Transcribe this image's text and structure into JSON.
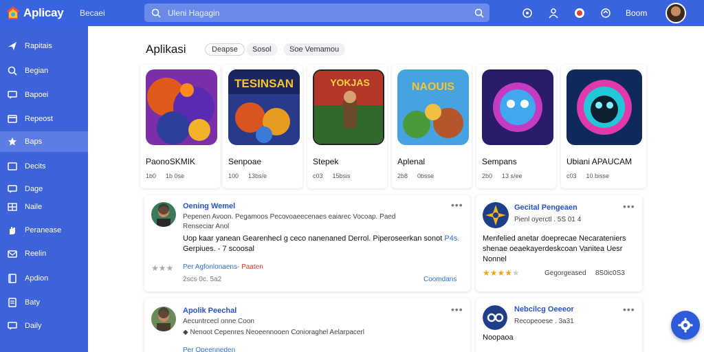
{
  "header": {
    "logo_text": "Aplicay",
    "link": "Becaei",
    "search_placeholder": "Uleni Hagagin",
    "user_label": "Boom"
  },
  "sidebar": {
    "items": [
      {
        "label": "Rapitais",
        "icon": "plane-icon"
      },
      {
        "label": "Begian",
        "icon": "search-icon"
      },
      {
        "label": "Bapoei",
        "icon": "chat-icon"
      },
      {
        "label": "Repeost",
        "icon": "cart-icon"
      },
      {
        "label": "Baps",
        "icon": "star-icon"
      },
      {
        "label": "Decits",
        "icon": "window-icon"
      },
      {
        "label": "Dage",
        "icon": "chat-icon"
      },
      {
        "label": "Naile",
        "icon": "grid-icon"
      },
      {
        "label": "Peranease",
        "icon": "hand-icon"
      },
      {
        "label": "Reelin",
        "icon": "mail-icon"
      },
      {
        "label": "Apdion",
        "icon": "book-icon"
      },
      {
        "label": "Baty",
        "icon": "document-icon"
      },
      {
        "label": "Daily",
        "icon": "chat-icon"
      }
    ]
  },
  "section": {
    "title": "Aplikasi",
    "chips": [
      "Deapse",
      "Sosol",
      "Soe Vemamou"
    ]
  },
  "apps": [
    {
      "name": "PaonoSKMIK",
      "meta1": "1b0",
      "meta2": "1b 0se"
    },
    {
      "name": "Senpoae",
      "meta1": "100",
      "meta2": "13bs/e"
    },
    {
      "name": "Stepek",
      "meta1": "c03",
      "meta2": "15bsis"
    },
    {
      "name": "Aplenal",
      "meta1": "2b8",
      "meta2": "0bsse"
    },
    {
      "name": "Sempans",
      "meta1": "2b0",
      "meta2": "13 s/ee"
    },
    {
      "name": "Ubiani APAUCAM",
      "meta1": "c03",
      "meta2": "10 bisse"
    }
  ],
  "reviews": [
    {
      "name": "Oening Wemel",
      "sub1": "Pepenen Avoon. Pegamoos Pecovoaeecenaes eaiarec Vocoap. Paed",
      "sub2": "Renseciar Anol",
      "body1": "Uop kaar yanean Gearenhecl g ceco nanenaned Derrol. Piperoseerkan sonot",
      "body_link": "P4s.",
      "body2": "Gerpiues. - 7 scoosal",
      "link_red": "Per Agfonlonaens-",
      "link_red2": "Paaten",
      "date": "2scs 0c. 5a2",
      "action": "Coomdans"
    },
    {
      "name": "Gecital Pengeaen",
      "sub1": "Pienl oyerctl . 5S 01 4",
      "body": "Menfelied anetar doeprecae Necarateniers shenae oeaekayerdeskcoan Vanitea Uesr Nonnel",
      "rating_label": "Gegorgeased",
      "rating_count": "8S0ic0S3"
    },
    {
      "name": "Apolik Peechal",
      "sub1": "Aecuntrcecl onne Coon",
      "sub2": "Nenoot Cepenres Neoeennooen Conioraghel  Aelarpacerl",
      "link_red": "Per Opeenneden"
    },
    {
      "name": "Nebcilcg Oeeeor",
      "sub1": "Recopeoese . 3a31",
      "body": "Noopaoa"
    }
  ],
  "colors": {
    "primary": "#3a63e0",
    "sidebar": "#3e62d8",
    "link": "#2553c9",
    "star": "#f2a612"
  }
}
